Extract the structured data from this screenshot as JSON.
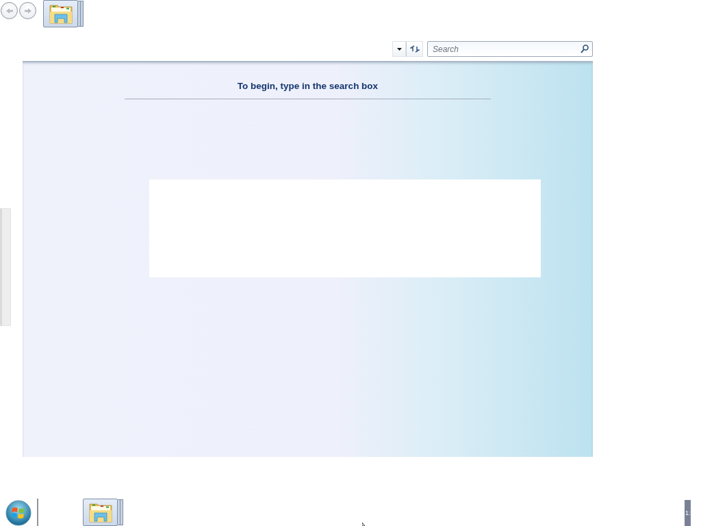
{
  "top_strip": {
    "items": [
      {
        "kind": "folder",
        "selected": true
      }
    ]
  },
  "toolbar": {
    "search": {
      "placeholder": "Search"
    }
  },
  "content": {
    "heading": "To begin, type in the search box"
  },
  "taskbar": {
    "items": [
      {
        "kind": "folder",
        "selected": true
      }
    ],
    "clock": "1:"
  }
}
